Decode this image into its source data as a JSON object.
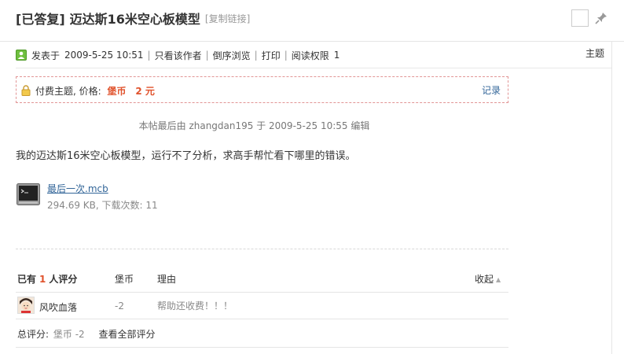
{
  "title": {
    "status_prefix": "[已答复]",
    "text": "迈达斯16米空心板模型",
    "copy_link": "[复制链接]"
  },
  "meta": {
    "posted_label": "发表于",
    "posted_time": "2009-5-25 10:51",
    "author_only": "只看该作者",
    "reverse_browse": "倒序浏览",
    "print": "打印",
    "read_perm_label": "阅读权限",
    "read_perm_value": "1",
    "topic_label": "主题"
  },
  "paid": {
    "label": "付费主题, 价格:",
    "currency": "堡币",
    "amount": "2 元",
    "record": "记录"
  },
  "edit_note": "本帖最后由 zhangdan195 于 2009-5-25 10:55 编辑",
  "post_body": "我的迈达斯16米空心板模型，运行不了分析，求高手帮忙看下哪里的错误。",
  "attachment": {
    "name": "最后一次.mcb",
    "info": "294.69 KB, 下载次数: 11",
    "icon": "terminal-file-icon"
  },
  "rating": {
    "header_prefix": "已有",
    "count": "1",
    "header_suffix": "人评分",
    "col_currency": "堡币",
    "col_reason": "理由",
    "collapse": "收起",
    "rows": [
      {
        "name": "风吹血落",
        "score": "-2",
        "reason": "帮助还收费！！！"
      }
    ],
    "total_label": "总评分:",
    "total_value": "堡币 -2",
    "view_all": "查看全部评分"
  },
  "colors": {
    "price": "#e0522c",
    "link": "#336699",
    "dashed_border": "#e29595"
  }
}
